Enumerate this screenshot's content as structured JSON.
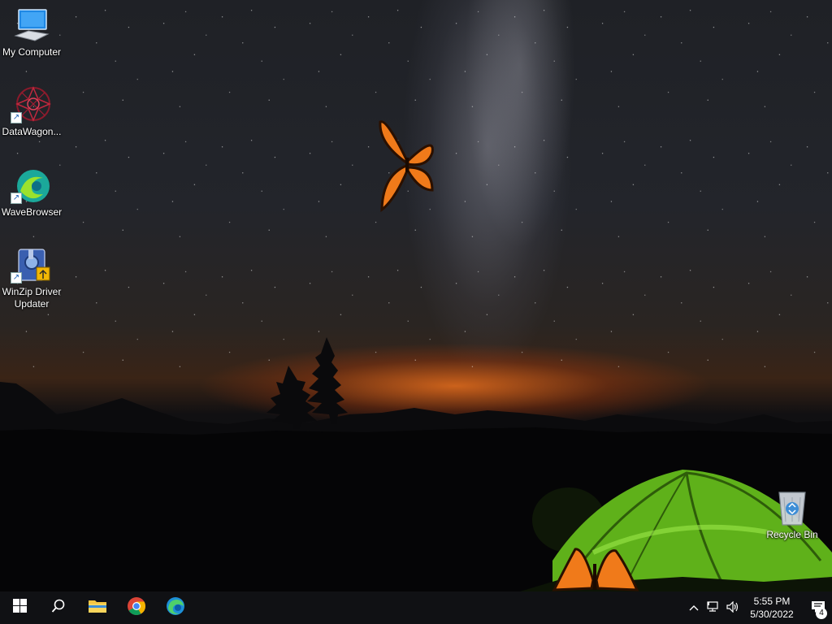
{
  "desktop": {
    "icons": [
      {
        "label": "My Computer",
        "icon": "computer-icon",
        "shortcut": false
      },
      {
        "label": "DataWagon...",
        "icon": "datawagon-icon",
        "shortcut": true
      },
      {
        "label": "WaveBrowser",
        "icon": "wavebrowser-icon",
        "shortcut": true
      },
      {
        "label": "WinZip Driver Updater",
        "icon": "winzip-driver-updater-icon",
        "shortcut": true
      }
    ],
    "recycle_bin": {
      "label": "Recycle Bin",
      "icon": "recycle-bin-icon"
    }
  },
  "taskbar": {
    "start": {
      "icon": "windows-logo-icon"
    },
    "search": {
      "icon": "search-icon"
    },
    "pinned": [
      {
        "name": "File Explorer",
        "icon": "file-explorer-icon"
      },
      {
        "name": "Google Chrome",
        "icon": "chrome-icon"
      },
      {
        "name": "Microsoft Edge",
        "icon": "edge-icon"
      }
    ],
    "tray": {
      "time": "5:55 PM",
      "date": "5/30/2022",
      "notification_count": "4"
    }
  },
  "colors": {
    "taskbar_bg": "#101114",
    "tent_green": "#7dd321",
    "butterfly_orange": "#f07a1a",
    "sunset_glow": "#ff7a1e"
  }
}
